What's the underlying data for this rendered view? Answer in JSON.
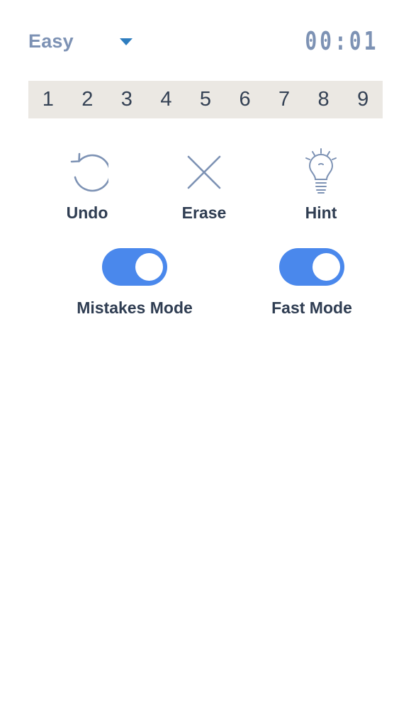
{
  "header": {
    "difficulty": "Easy",
    "timer": "00:01"
  },
  "numpad": {
    "keys": [
      "1",
      "2",
      "3",
      "4",
      "5",
      "6",
      "7",
      "8",
      "9"
    ]
  },
  "tools": {
    "undo": {
      "label": "Undo",
      "icon": "undo-icon"
    },
    "erase": {
      "label": "Erase",
      "icon": "close-icon"
    },
    "hint": {
      "label": "Hint",
      "icon": "lightbulb-icon"
    }
  },
  "toggles": {
    "mistakes": {
      "label": "Mistakes Mode",
      "on": true
    },
    "fast": {
      "label": "Fast Mode",
      "on": true
    }
  },
  "colors": {
    "accent": "#4a88ec",
    "header_text": "#7d92b4",
    "numpad_bg": "#ebe8e3",
    "label_text": "#2f3d52",
    "dropdown_arrow": "#2e7dbf"
  }
}
